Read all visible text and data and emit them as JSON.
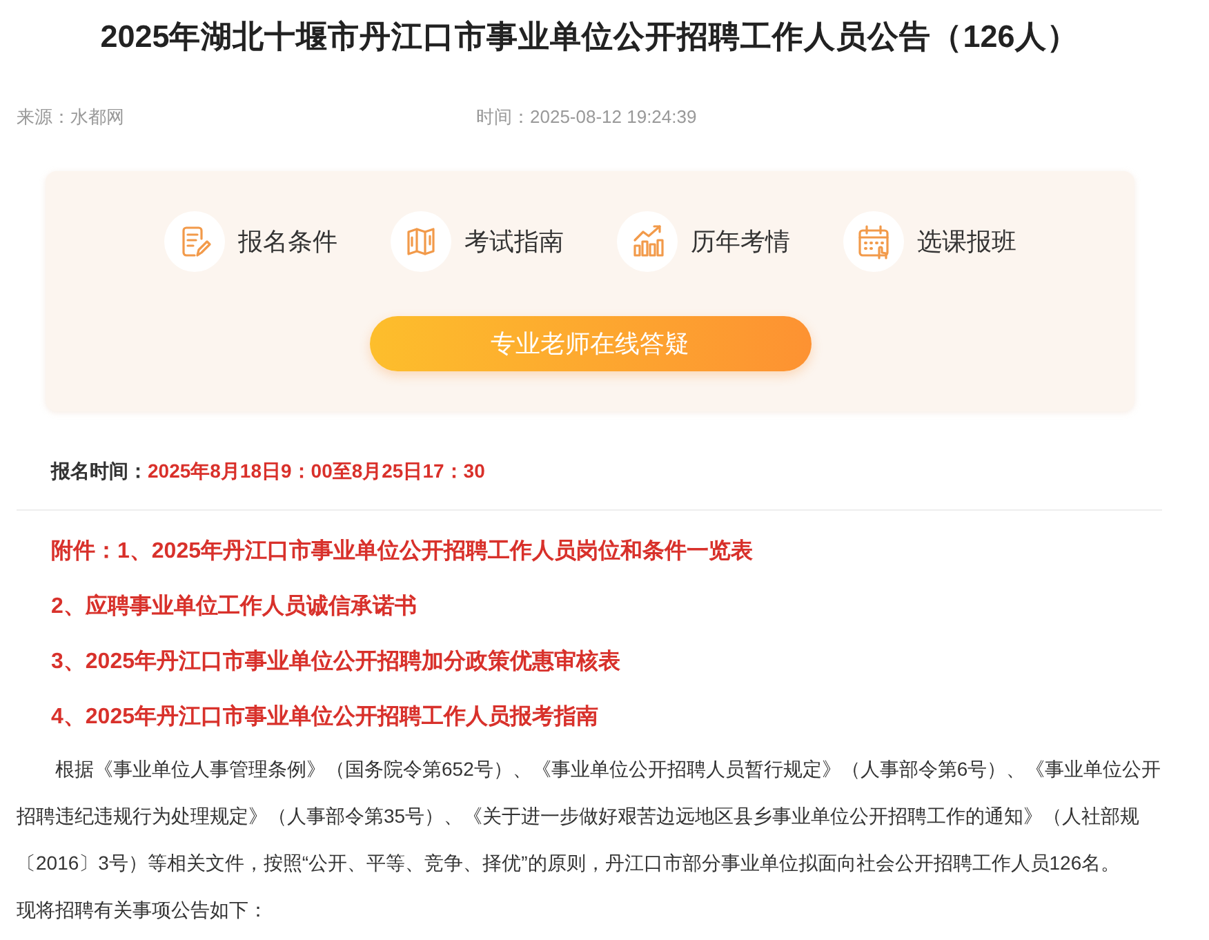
{
  "title": "2025年湖北十堰市丹江口市事业单位公开招聘工作人员公告（126人）",
  "meta": {
    "source": "来源：水都网",
    "time": "时间：2025-08-12 19:24:39"
  },
  "quick_links": [
    {
      "kind": "form",
      "label": "报名条件"
    },
    {
      "kind": "map",
      "label": "考试指南"
    },
    {
      "kind": "chart",
      "label": "历年考情"
    },
    {
      "kind": "calendar",
      "label": "选课报班"
    }
  ],
  "consult_button": "专业老师在线答疑",
  "registration": {
    "label": "报名时间：",
    "value": "2025年8月18日9：00至8月25日17：30"
  },
  "attachments": [
    "附件：1、2025年丹江口市事业单位公开招聘工作人员岗位和条件一览表",
    "2、应聘事业单位工作人员诚信承诺书",
    "3、2025年丹江口市事业单位公开招聘加分政策优惠审核表",
    "4、2025年丹江口市事业单位公开招聘工作人员报考指南"
  ],
  "paragraphs": [
    {
      "text": "根据《事业单位人事管理条例》（国务院令第652号）、《事业单位公开招聘人员暂行规定》（人事部令第6号）、《事业单位公开招聘违纪违规行为处理规定》（人事部令第35号）、《关于进一步做好艰苦边远地区县乡事业单位公开招聘工作的通知》（人社部规〔2016〕3号）等相关文件，按照“公开、平等、竞争、择优”的原则，丹江口市部分事业单位拟面向社会公开招聘工作人员126名。",
      "indented": true
    },
    {
      "text": "现将招聘有关事项公告如下：",
      "indented": false
    }
  ]
}
